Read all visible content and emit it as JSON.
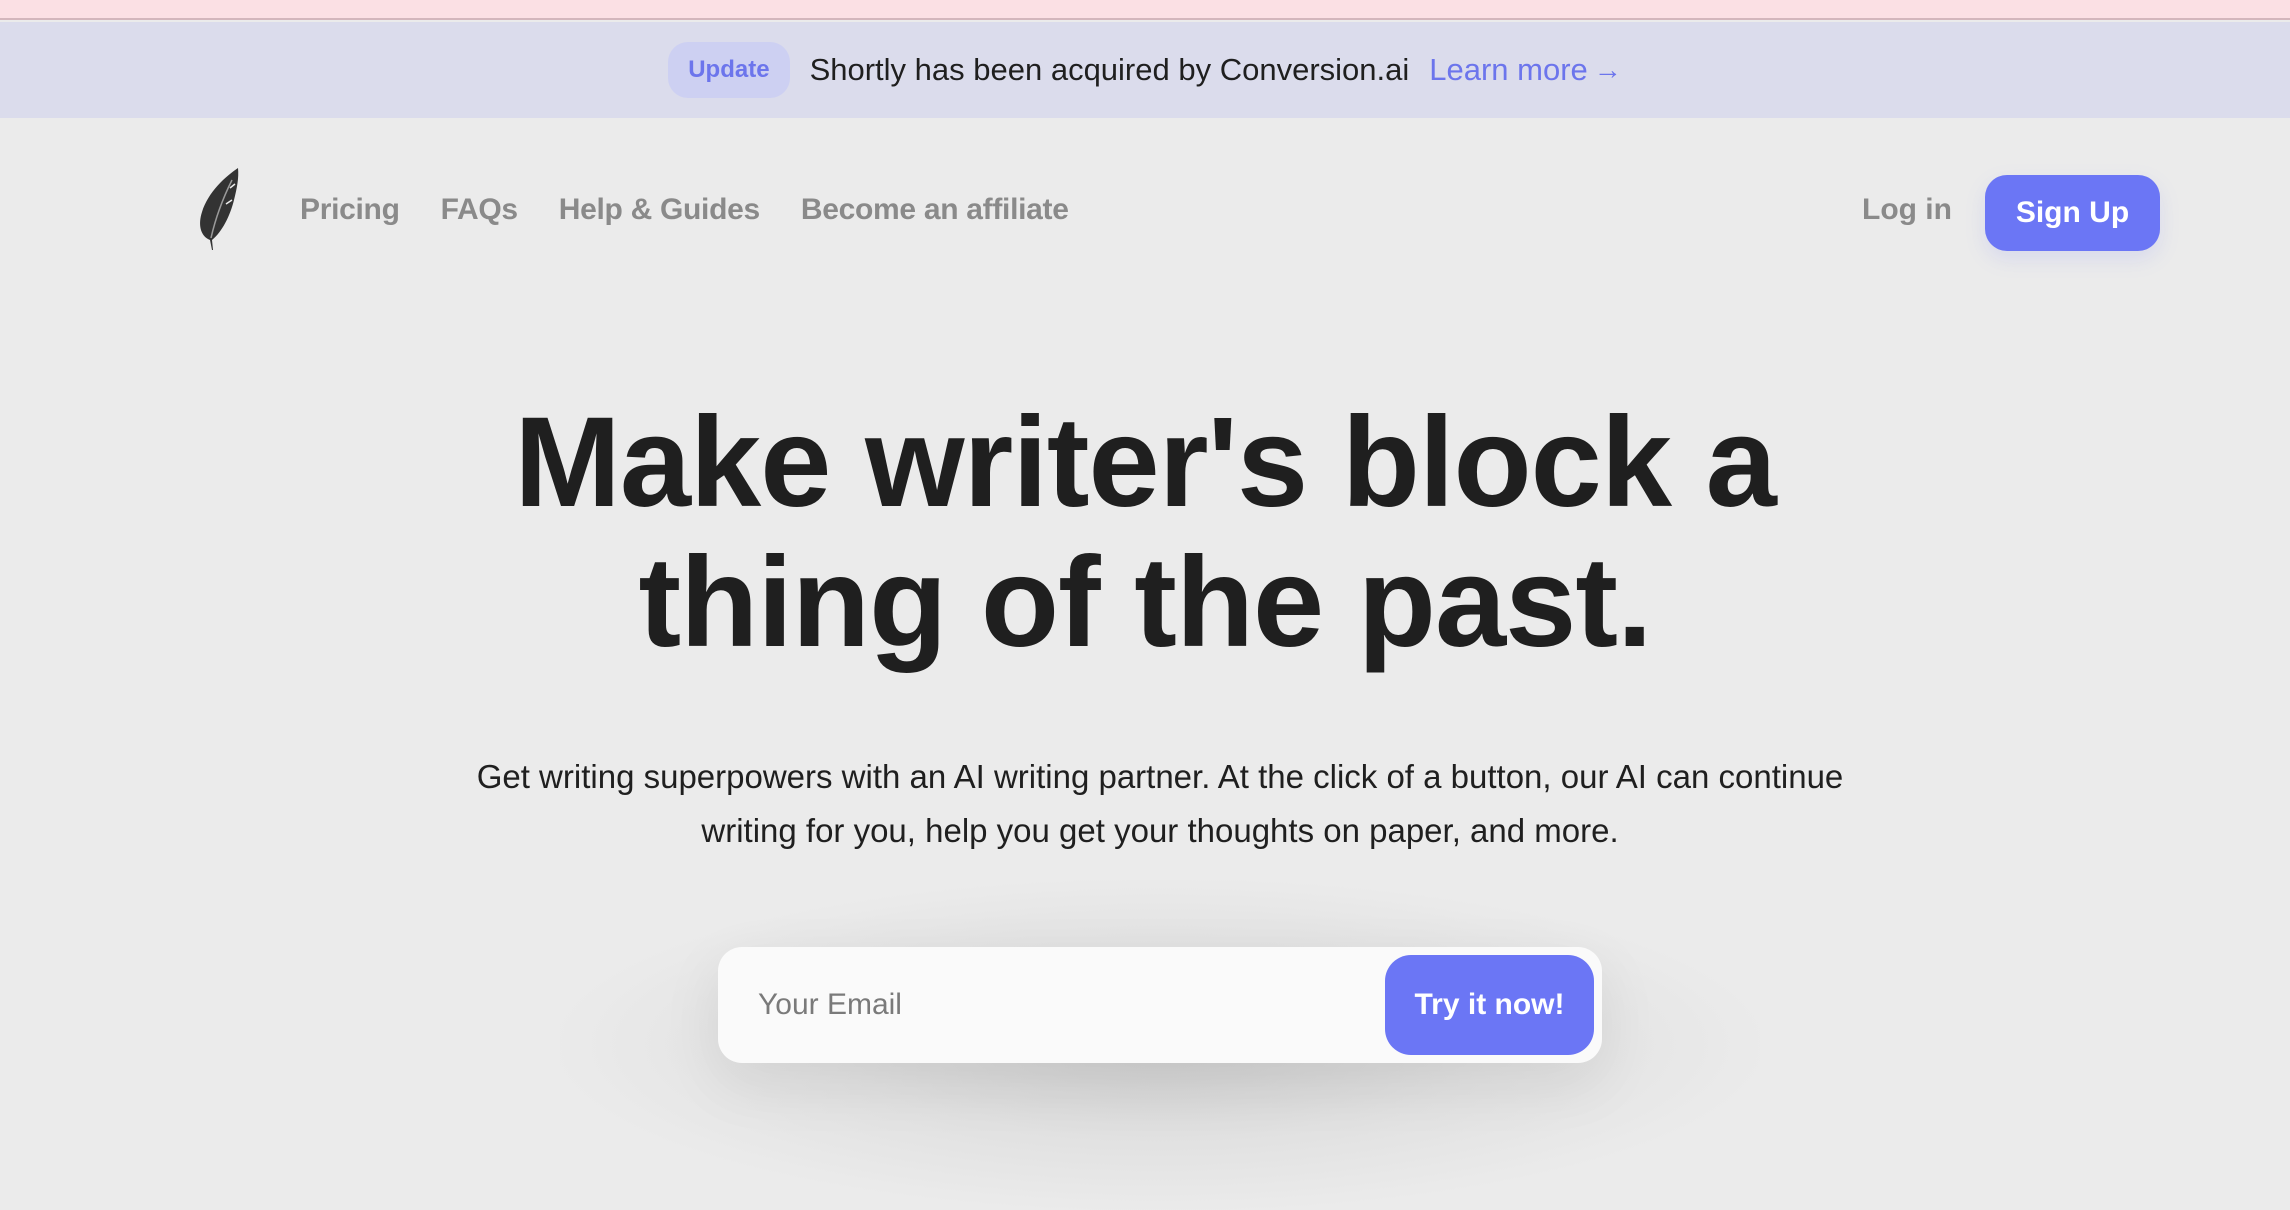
{
  "announcement": {
    "badge": "Update",
    "text": "Shortly has been acquired by Conversion.ai",
    "link_label": "Learn more",
    "link_arrow": "→"
  },
  "nav": {
    "logo_icon": "feather-icon",
    "links": [
      {
        "label": "Pricing"
      },
      {
        "label": "FAQs"
      },
      {
        "label": "Help & Guides"
      },
      {
        "label": "Become an affiliate"
      }
    ],
    "login_label": "Log in",
    "signup_label": "Sign Up"
  },
  "hero": {
    "title_line1": "Make writer's block a",
    "title_line2": "thing of the past.",
    "subtitle_line1": "Get writing superpowers with an AI writing partner. At the click of a button, our AI can continue",
    "subtitle_line2": "writing for you, help you get your thoughts on paper, and more."
  },
  "cta": {
    "email_placeholder": "Your Email",
    "email_value": "",
    "button_label": "Try it now!"
  },
  "colors": {
    "accent": "#6b76f5",
    "banner_bg": "#dbdcec",
    "page_bg": "#ebebeb",
    "top_strip": "#fbe0e4"
  }
}
